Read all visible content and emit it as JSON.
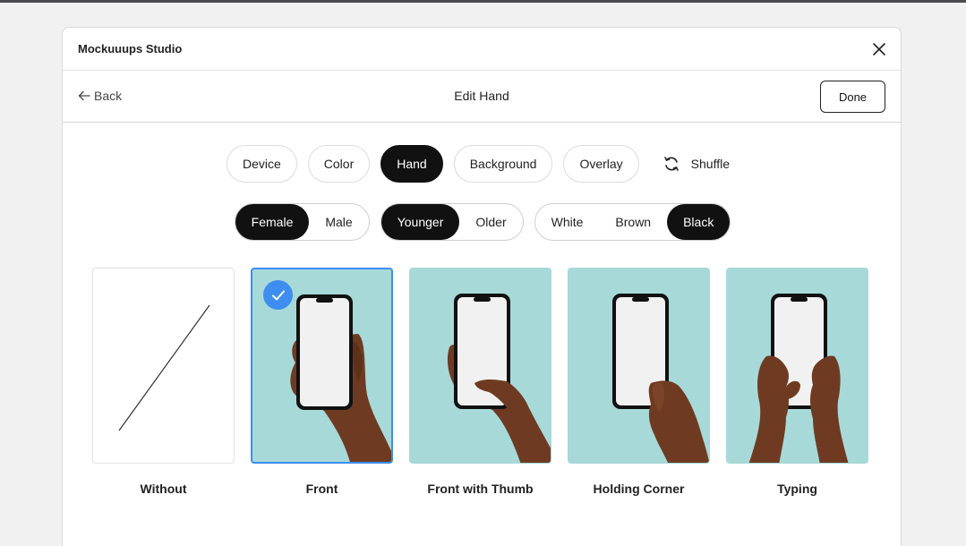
{
  "window": {
    "title": "Mockuuups Studio"
  },
  "header": {
    "back_label": "Back",
    "title": "Edit Hand",
    "done_label": "Done"
  },
  "tabs": [
    {
      "label": "Device",
      "active": false
    },
    {
      "label": "Color",
      "active": false
    },
    {
      "label": "Hand",
      "active": true
    },
    {
      "label": "Background",
      "active": false
    },
    {
      "label": "Overlay",
      "active": false
    }
  ],
  "shuffle_label": "Shuffle",
  "options": {
    "gender": {
      "items": [
        "Female",
        "Male"
      ],
      "selected": "Female"
    },
    "age": {
      "items": [
        "Younger",
        "Older"
      ],
      "selected": "Younger"
    },
    "skin": {
      "items": [
        "White",
        "Brown",
        "Black"
      ],
      "selected": "Black"
    }
  },
  "cards": [
    {
      "label": "Without",
      "selected": false
    },
    {
      "label": "Front",
      "selected": true
    },
    {
      "label": "Front with Thumb",
      "selected": false
    },
    {
      "label": "Holding Corner",
      "selected": false
    },
    {
      "label": "Typing",
      "selected": false
    }
  ],
  "colors": {
    "accent": "#3d8ef0",
    "thumb_background": "#a7d9d8",
    "skin": "#6e3b22",
    "active_pill": "#111111"
  }
}
